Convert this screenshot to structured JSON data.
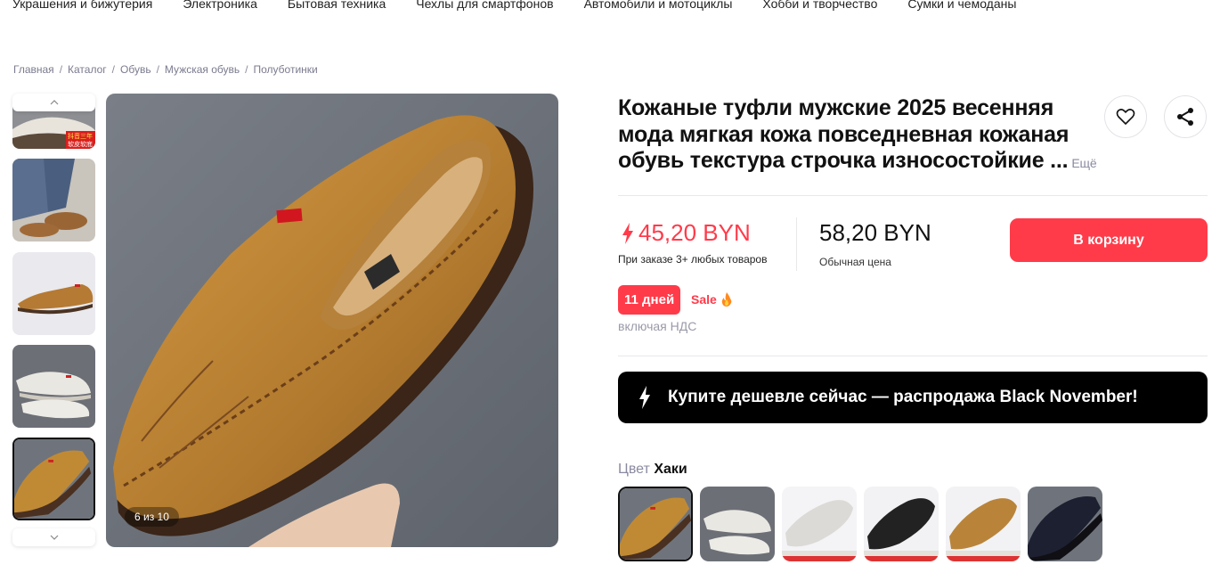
{
  "topnav": {
    "items": [
      "Украшения и бижутерия",
      "Электроника",
      "Бытовая техника",
      "Чехлы для смартфонов",
      "Автомобили и мотоциклы",
      "Хобби и творчество",
      "Сумки и чемоданы"
    ]
  },
  "breadcrumb": [
    "Главная",
    "Каталог",
    "Обувь",
    "Мужская обувь",
    "Полуботинки"
  ],
  "breadcrumb_sep": "/",
  "gallery": {
    "counter": "6 из 10",
    "thumb_badge_line1": "抖音三年",
    "thumb_badge_line2": "软皮软底"
  },
  "product": {
    "title": "Кожаные туфли мужские 2025 весенняя мода мягкая кожа повседневная кожаная обувь текстура строчка износостойкие ...",
    "title_more": "Ещё",
    "sale_price": "45,20 BYN",
    "sale_note": "При заказе 3+ любых товаров",
    "regular_price": "58,20 BYN",
    "regular_note": "Обычная цена",
    "add_to_cart": "В корзину",
    "days_badge": "11 дней",
    "sale_label": "Sale",
    "vat_note": "включая НДС",
    "promo_text": "Купите дешевле сейчас — распродажа Black November!",
    "color_key": "Цвет",
    "color_value": "Хаки"
  },
  "colors": {
    "accent": "#ff3b4a",
    "promo_bg": "#000000",
    "tan_shoe": "#c08a35",
    "main_bg": "#6f747c"
  }
}
